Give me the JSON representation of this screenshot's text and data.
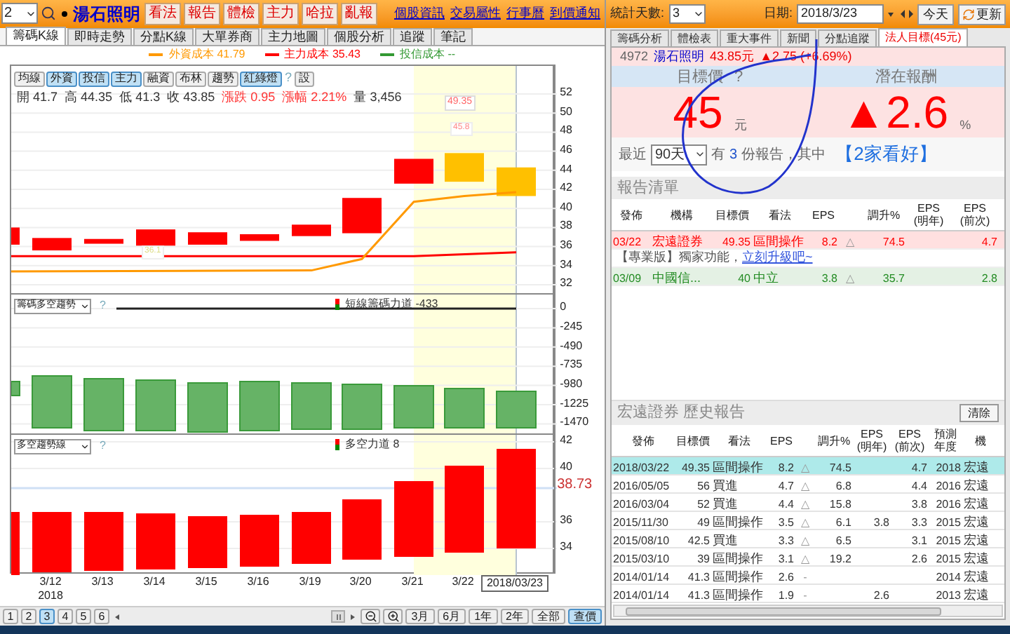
{
  "toolbar": {
    "stock_code": "2",
    "stock_name": "湯石照明",
    "action_buttons": [
      "看法",
      "報告",
      "體檢",
      "主力",
      "哈拉",
      "亂報"
    ],
    "links": [
      "個股資訊",
      "交易屬性",
      "行事曆",
      "到價通知"
    ]
  },
  "main_tabs": [
    {
      "label": "籌碼K線",
      "selected": true
    },
    {
      "label": "即時走勢",
      "selected": false
    },
    {
      "label": "分點K線",
      "selected": false
    },
    {
      "label": "大單券商",
      "selected": false
    },
    {
      "label": "主力地圖",
      "selected": false
    },
    {
      "label": "個股分析",
      "selected": false
    },
    {
      "label": "追蹤",
      "selected": false
    },
    {
      "label": "筆記",
      "selected": false
    }
  ],
  "legend": [
    {
      "text": "外資成本 41.79",
      "color": "#ff9900"
    },
    {
      "text": "主力成本 35.43",
      "color": "#ff0000"
    },
    {
      "text": "投信成本 --",
      "color": "#339933"
    }
  ],
  "chart_toggles": [
    {
      "label": "均線",
      "selected": false
    },
    {
      "label": "外資",
      "selected": true
    },
    {
      "label": "投信",
      "selected": true
    },
    {
      "label": "主力",
      "selected": true
    },
    {
      "label": "融資",
      "selected": false
    },
    {
      "label": "布林",
      "selected": false
    },
    {
      "label": "趨勢",
      "selected": false
    },
    {
      "label": "紅綠燈",
      "selected": true
    }
  ],
  "chart_help": "?",
  "chart_settings": "設",
  "ohlc": [
    {
      "text": "開 41.7",
      "color": "#333333"
    },
    {
      "text": "高 44.35",
      "color": "#333333"
    },
    {
      "text": "低 41.3",
      "color": "#333333"
    },
    {
      "text": "收 43.85",
      "color": "#333333"
    },
    {
      "text": "漲跌 0.95",
      "color": "#ff3333"
    },
    {
      "text": "漲幅 2.21%",
      "color": "#ff3333"
    },
    {
      "text": "量 3,456",
      "color": "#333333"
    }
  ],
  "price_axis": [
    "52",
    "50",
    "48",
    "46",
    "44",
    "42",
    "40",
    "38",
    "36",
    "34",
    "32"
  ],
  "price_tags": [
    "49.35",
    "45.8",
    "36.1"
  ],
  "trend_panel": {
    "select": "籌碼多空趨勢",
    "help": "?",
    "legend": "短線籌碼力道 -433",
    "axis": [
      "0",
      "-245",
      "-490",
      "-735",
      "-980",
      "-1225",
      "-1470"
    ]
  },
  "power_panel": {
    "select": "多空趨勢線",
    "help": "?",
    "legend": "多空力道 8",
    "axis": [
      "42",
      "40",
      "36",
      "34"
    ],
    "current": "38.73"
  },
  "dates": [
    {
      "label": "3/12",
      "year": "2018",
      "selected": false
    },
    {
      "label": "3/13",
      "selected": false
    },
    {
      "label": "3/14",
      "selected": false
    },
    {
      "label": "3/15",
      "selected": false
    },
    {
      "label": "3/16",
      "selected": false
    },
    {
      "label": "3/19",
      "selected": false
    },
    {
      "label": "3/20",
      "selected": false
    },
    {
      "label": "3/21",
      "selected": false
    },
    {
      "label": "3/22",
      "selected": false
    },
    {
      "label": "2018/03/23",
      "selected": true
    }
  ],
  "pages": [
    {
      "label": "1",
      "selected": false
    },
    {
      "label": "2",
      "selected": false
    },
    {
      "label": "3",
      "selected": true
    },
    {
      "label": "4",
      "selected": false
    },
    {
      "label": "5",
      "selected": false
    },
    {
      "label": "6",
      "selected": false
    }
  ],
  "ranges": [
    {
      "label": "3月",
      "selected": false
    },
    {
      "label": "6月",
      "selected": false
    },
    {
      "label": "1年",
      "selected": false
    },
    {
      "label": "2年",
      "selected": false
    },
    {
      "label": "全部",
      "selected": false
    },
    {
      "label": "查價",
      "selected": true
    }
  ],
  "stats": {
    "days_label": "統計天數:",
    "days": "3",
    "date_label": "日期:",
    "date": "2018/3/23",
    "today": "今天",
    "refresh": "更新"
  },
  "side_tabs": [
    {
      "label": "籌碼分析",
      "selected": false
    },
    {
      "label": "體檢表",
      "selected": false
    },
    {
      "label": "重大事件",
      "selected": false
    },
    {
      "label": "新聞",
      "selected": false
    },
    {
      "label": "分點追蹤",
      "selected": false
    },
    {
      "label": "法人目標(45元)",
      "selected": true
    }
  ],
  "quote": {
    "code": "4972",
    "name": "湯石照明",
    "price": "43.85元",
    "change": "▲2.75 (+6.69%)"
  },
  "target": {
    "label": "目標價",
    "help": "?",
    "value": "45",
    "unit": "元",
    "return_label": "潛在報酬",
    "return": "▲2.6",
    "return_unit": "%"
  },
  "summary": {
    "prefix": "最近",
    "period": "90天",
    "has": "有",
    "count": "3",
    "suffix": "份報告，其中",
    "highlight": "【2家看好】"
  },
  "reports": {
    "title": "報告清單",
    "columns": [
      "發佈",
      "機構",
      "目標價",
      "看法",
      "EPS",
      "調升%",
      "EPS\n(明年)",
      "EPS\n(前次)"
    ],
    "rows": [
      {
        "kind": "report",
        "color": "#ff0000",
        "date": "03/22",
        "broker": "宏遠證券",
        "target": "49.35",
        "view": "區間操作",
        "eps": "8.2",
        "trend": "△",
        "change": "74.5",
        "eps_prev": "4.7"
      },
      {
        "kind": "promo",
        "text": "【專業版】獨家功能，",
        "link": "立刻升級吧~"
      },
      {
        "kind": "report",
        "color": "#228b22",
        "date": "03/09",
        "broker": "中國信...",
        "target": "40",
        "view": "中立",
        "eps": "3.8",
        "trend": "△",
        "change": "35.7",
        "eps_prev": "2.8"
      }
    ]
  },
  "history": {
    "title": "宏遠證券 歷史報告",
    "clear": "清除",
    "columns": [
      "發佈",
      "目標價",
      "看法",
      "EPS",
      "調升%",
      "EPS\n(明年)",
      "EPS\n(前次)",
      "預測年度",
      "機"
    ],
    "rows": [
      {
        "selected": true,
        "date": "2018/03/22",
        "target": "49.35",
        "view": "區間操作",
        "eps": "8.2",
        "trend": "△",
        "change": "74.5",
        "eps_prev": "4.7",
        "year": "2018",
        "broker": "宏遠"
      },
      {
        "selected": false,
        "date": "2016/05/05",
        "target": "56",
        "view": "買進",
        "eps": "4.7",
        "trend": "△",
        "change": "6.8",
        "eps_prev": "4.4",
        "year": "2016",
        "broker": "宏遠"
      },
      {
        "selected": false,
        "date": "2016/03/04",
        "target": "52",
        "view": "買進",
        "eps": "4.4",
        "trend": "△",
        "change": "15.8",
        "eps_prev": "3.8",
        "year": "2016",
        "broker": "宏遠"
      },
      {
        "selected": false,
        "date": "2015/11/30",
        "target": "49",
        "view": "區間操作",
        "eps": "3.5",
        "trend": "△",
        "change": "6.1",
        "eps_next": "3.8",
        "eps_prev": "3.3",
        "year": "2015",
        "broker": "宏遠"
      },
      {
        "selected": false,
        "date": "2015/08/10",
        "target": "42.5",
        "view": "買進",
        "eps": "3.3",
        "trend": "△",
        "change": "6.5",
        "eps_prev": "3.1",
        "year": "2015",
        "broker": "宏遠"
      },
      {
        "selected": false,
        "date": "2015/03/10",
        "target": "39",
        "view": "區間操作",
        "eps": "3.1",
        "trend": "△",
        "change": "19.2",
        "eps_prev": "2.6",
        "year": "2015",
        "broker": "宏遠"
      },
      {
        "selected": false,
        "date": "2014/01/14",
        "target": "41.3",
        "view": "區間操作",
        "eps": "2.6",
        "trend": "-",
        "year": "2014",
        "broker": "宏遠"
      },
      {
        "selected": false,
        "date": "2014/01/14",
        "target": "41.3",
        "view": "區間操作",
        "eps": "1.9",
        "trend": "-",
        "eps_next": "2.6",
        "year": "2013",
        "broker": "宏遠"
      }
    ]
  }
}
